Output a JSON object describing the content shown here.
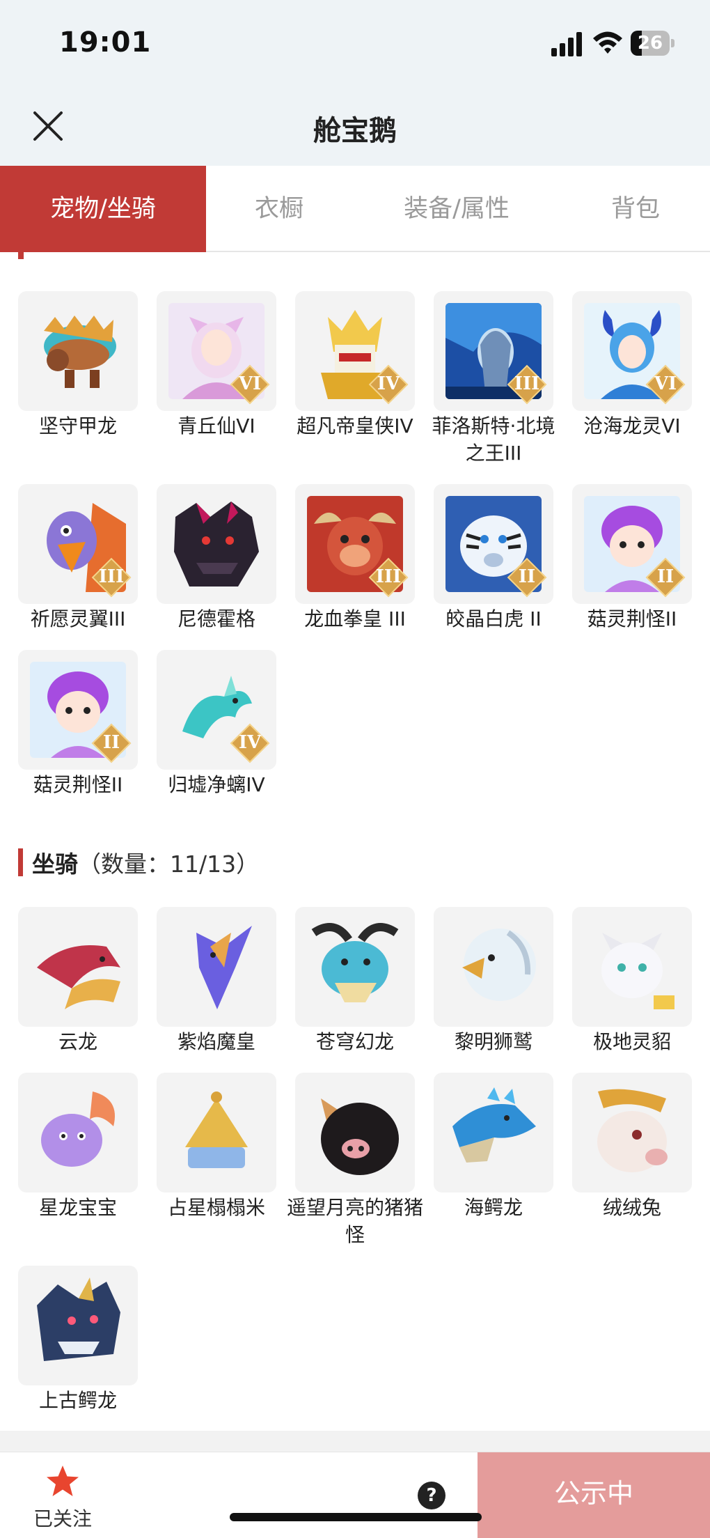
{
  "status_bar": {
    "time": "19:01",
    "battery": "26"
  },
  "header": {
    "title": "舱宝鹅"
  },
  "tabs": [
    {
      "label": "宠物/坐骑",
      "active": true
    },
    {
      "label": "衣橱",
      "active": false
    },
    {
      "label": "装备/属性",
      "active": false
    },
    {
      "label": "背包",
      "active": false
    }
  ],
  "pets": {
    "items": [
      {
        "name": "坚守甲龙",
        "badge": ""
      },
      {
        "name": "青丘仙VI",
        "badge": "VI"
      },
      {
        "name": "超凡帝皇侠IV",
        "badge": "IV"
      },
      {
        "name": "菲洛斯特·北境之王III",
        "badge": "III"
      },
      {
        "name": "沧海龙灵VI",
        "badge": "VI"
      },
      {
        "name": "祈愿灵翼III",
        "badge": "III"
      },
      {
        "name": "尼德霍格",
        "badge": ""
      },
      {
        "name": "龙血拳皇 III",
        "badge": "III"
      },
      {
        "name": "皎晶白虎 II",
        "badge": "II"
      },
      {
        "name": "菇灵荆怪II",
        "badge": "II"
      },
      {
        "name": "菇灵荆怪II",
        "badge": "II"
      },
      {
        "name": "归墟净螭IV",
        "badge": "IV"
      }
    ]
  },
  "mounts": {
    "title": "坐骑",
    "count": "（数量：11/13）",
    "items": [
      {
        "name": "云龙"
      },
      {
        "name": "紫焰魔皇"
      },
      {
        "name": "苍穹幻龙"
      },
      {
        "name": "黎明狮鹫"
      },
      {
        "name": "极地灵貂"
      },
      {
        "name": "星龙宝宝"
      },
      {
        "name": "占星榻榻米"
      },
      {
        "name": "遥望月亮的猪猪怪"
      },
      {
        "name": "海鳄龙"
      },
      {
        "name": "绒绒兔"
      },
      {
        "name": "上古鳄龙"
      }
    ]
  },
  "bottom_bar": {
    "follow_label": "已关注",
    "help_symbol": "?",
    "public_label": "公示中"
  },
  "colors": {
    "accent": "#c13a36",
    "public_button": "#e49c9b",
    "star": "#e8452f"
  }
}
